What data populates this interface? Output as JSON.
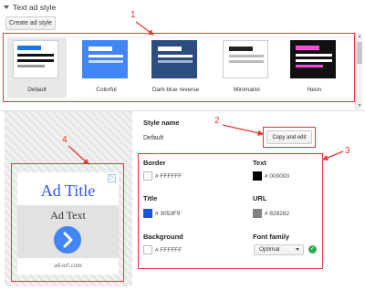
{
  "header": {
    "title": "Text ad style"
  },
  "toolbar": {
    "create_label": "Create ad style"
  },
  "styles": [
    {
      "label": "Default",
      "selected": true
    },
    {
      "label": "Colorful",
      "selected": false
    },
    {
      "label": "Dark blue reverse",
      "selected": false
    },
    {
      "label": "Minimalist",
      "selected": false
    },
    {
      "label": "Neon",
      "selected": false
    }
  ],
  "editor": {
    "style_name_label": "Style name",
    "style_name_value": "Default",
    "copy_label": "Copy and edit",
    "border": {
      "label": "Border",
      "value": "# FFFFFF",
      "color": "#ffffff"
    },
    "text": {
      "label": "Text",
      "value": "# 000000",
      "color": "#000000"
    },
    "title": {
      "label": "Title",
      "value": "# 3053F9",
      "color": "#3053f9"
    },
    "url": {
      "label": "URL",
      "value": "# 828282",
      "color": "#828282"
    },
    "background": {
      "label": "Background",
      "value": "# FFFFFF",
      "color": "#ffffff"
    },
    "font_family": {
      "label": "Font family",
      "value": "Optimal"
    }
  },
  "preview": {
    "ad_title": "Ad Title",
    "ad_text": "Ad Text",
    "ad_url": "ad-url.com"
  },
  "annotations": [
    "1",
    "2",
    "3",
    "4"
  ]
}
